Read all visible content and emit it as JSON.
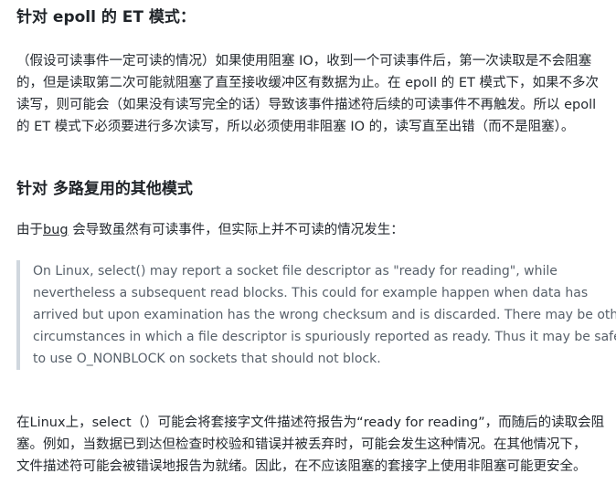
{
  "section1": {
    "heading": "针对 epoll 的 ET 模式：",
    "lines": [
      "（假设可读事件一定可读的情况）如果使用阻塞 IO，收到一个可读事件后，第一次读取是不会阻塞",
      "的，但是读取第二次可能就阻塞了直至接收缓冲区有数据为止。在 epoll 的 ET 模式下，如果不多次",
      "读写，则可能会（如果没有读写完全的话）导致该事件描述符后续的可读事件不再触发。所以 epoll",
      "的 ET 模式下必须要进行多次读写，所以必须使用非阻塞 IO 的，读写直至出错（而不是阻塞）。"
    ]
  },
  "section2": {
    "heading": "针对 多路复用的其他模式",
    "intro_prefix": "由于",
    "intro_link": "bug",
    "intro_suffix": " 会导致虽然有可读事件，但实际上并不可读的情况发生：",
    "quote_lines": [
      "On Linux, select() may report a socket file descriptor as \"ready for reading\", while",
      "nevertheless a subsequent read blocks. This could for example happen when data has",
      "arrived but upon examination has the wrong checksum and is discarded. There may be other",
      "circumstances in which a file descriptor is spuriously reported as ready. Thus it may be safer",
      "to use O_NONBLOCK on sockets that should not block."
    ],
    "translation_lines": [
      "在Linux上，select（）可能会将套接字文件描述符报告为“ready for reading”，而随后的读取会阻",
      "塞。例如，当数据已到达但检查时校验和错误并被丢弃时，可能会发生这种情况。在其他情况下，",
      "文件描述符可能会被错误地报告为就绪。因此，在不应该阻塞的套接字上使用非阻塞可能更安全。"
    ]
  }
}
